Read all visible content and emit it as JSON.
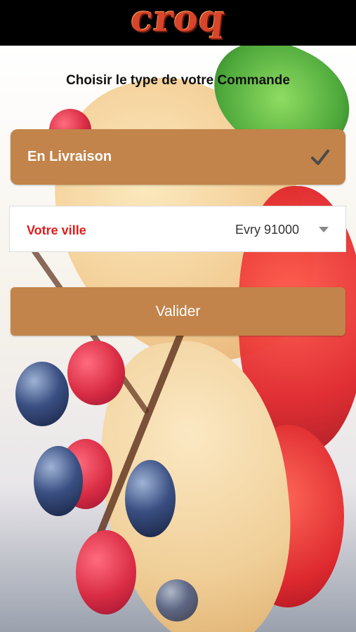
{
  "header": {
    "logo_text": "croq"
  },
  "main": {
    "heading": "Choisir le type de votre Commande",
    "order_type": {
      "label": "En Livraison",
      "selected": true,
      "icon": "checkmark-icon"
    },
    "city": {
      "label": "Votre ville",
      "value": "Evry 91000",
      "icon": "caret-down-icon"
    },
    "submit_label": "Valider"
  },
  "colors": {
    "accent": "#c2844a",
    "header_bg": "#000000",
    "label_red": "#e31b1b"
  }
}
